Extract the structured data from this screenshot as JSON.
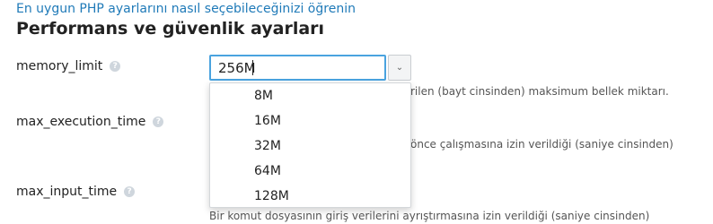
{
  "header": {
    "learn_link": "En uygun PHP ayarlarını nasıl seçebileceğinizi öğrenin",
    "title": "Performans ve güvenlik ayarları"
  },
  "fields": [
    {
      "label": "memory_limit",
      "value": "256M",
      "description": "rilen (bayt cinsinden) maksimum bellek miktarı."
    },
    {
      "label": "max_execution_time",
      "description": "önce çalışmasına izin verildiği (saniye cinsinden)"
    },
    {
      "label": "max_input_time",
      "description": "Bir komut dosyasının giriş verilerini ayrıştırmasına izin verildiği (saniye cinsinden)"
    }
  ],
  "help_icon": {
    "glyph": "?",
    "name": "help-icon"
  },
  "dropdown": {
    "toggle_glyph": "⌄",
    "options": [
      "8M",
      "16M",
      "32M",
      "64M",
      "128M"
    ]
  },
  "colors": {
    "link": "#1f7ab8",
    "focus_border": "#4aa3df",
    "help_icon_bg": "#cfd6dd"
  }
}
